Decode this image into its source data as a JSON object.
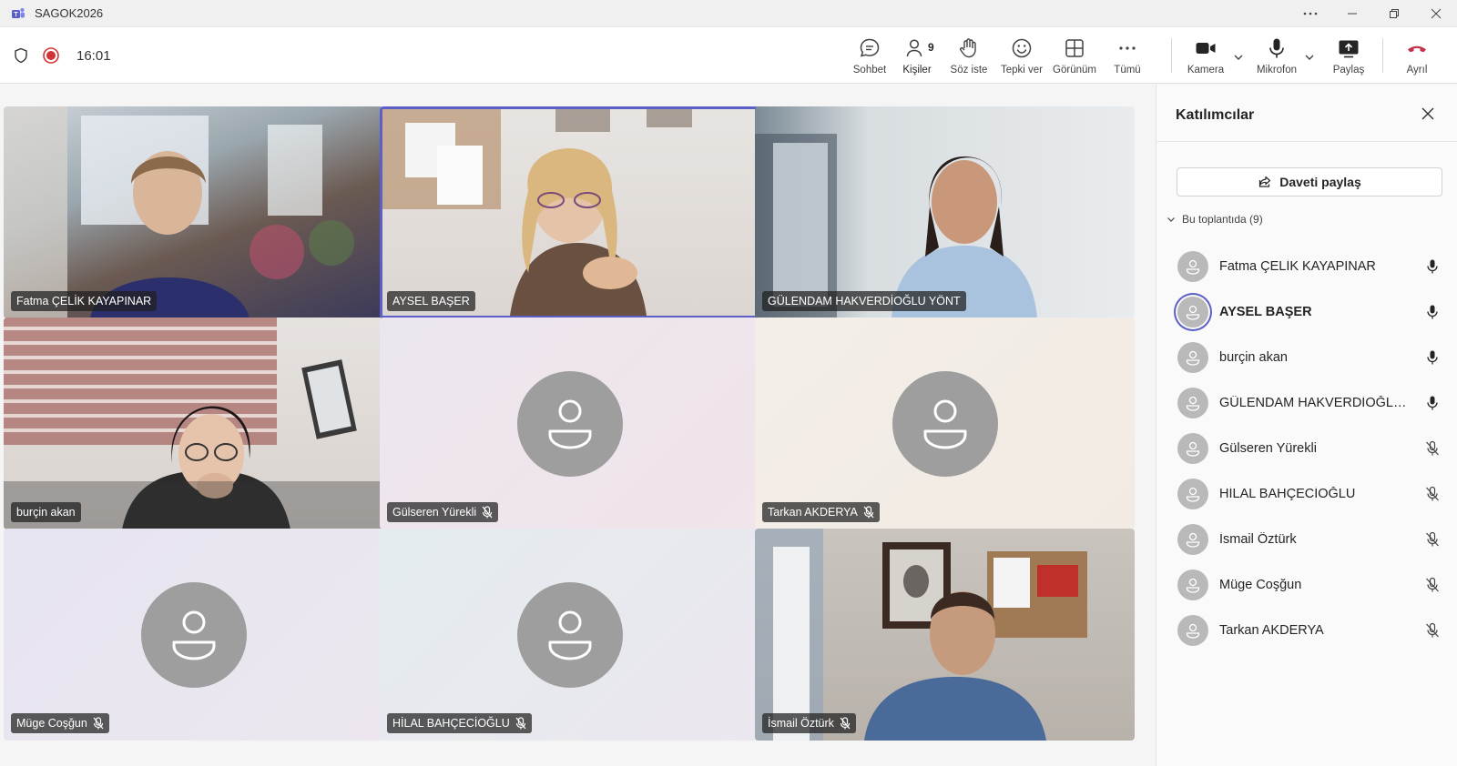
{
  "window": {
    "title": "SAGOK2026"
  },
  "meeting": {
    "timer": "16:01",
    "people_count": "9"
  },
  "toolbar": {
    "chat": "Sohbet",
    "people": "Kişiler",
    "raise_hand": "Söz iste",
    "react": "Tepki ver",
    "view": "Görünüm",
    "more": "Tümü",
    "camera": "Kamera",
    "mic": "Mikrofon",
    "share": "Paylaş",
    "leave": "Ayrıl"
  },
  "colors": {
    "accent": "#5b5fc7",
    "leave": "#c4314b",
    "record": "#d13438"
  },
  "tiles": [
    {
      "name": "Fatma ÇELİK KAYAPINAR",
      "video": true,
      "muted": false
    },
    {
      "name": "AYSEL BAŞER",
      "video": true,
      "muted": false,
      "speaking": true
    },
    {
      "name": "GÜLENDAM HAKVERDİOĞLU YÖNT",
      "video": true,
      "muted": false
    },
    {
      "name": "burçin akan",
      "video": true,
      "muted": false
    },
    {
      "name": "Gülseren Yürekli",
      "video": false,
      "muted": true
    },
    {
      "name": "Tarkan AKDERYA",
      "video": false,
      "muted": true
    },
    {
      "name": "Müge Coşğun",
      "video": false,
      "muted": true
    },
    {
      "name": "HİLAL BAHÇECİOĞLU",
      "video": false,
      "muted": true
    },
    {
      "name": "İsmail Öztürk",
      "video": true,
      "muted": true
    }
  ],
  "panel": {
    "title": "Katılımcılar",
    "invite": "Daveti paylaş",
    "section": "Bu toplantıda (9)",
    "participants": [
      {
        "name": "Fatma ÇELİK KAYAPINAR",
        "muted": false
      },
      {
        "name": "AYSEL BAŞER",
        "muted": false,
        "speaking": true
      },
      {
        "name": "burçin akan",
        "muted": false
      },
      {
        "name": "GÜLENDAM HAKVERDİOĞLU YÖNT",
        "muted": false
      },
      {
        "name": "Gülseren Yürekli",
        "muted": true
      },
      {
        "name": "HİLAL BAHÇECİOĞLU",
        "muted": true
      },
      {
        "name": "İsmail Öztürk",
        "muted": true
      },
      {
        "name": "Müge Coşğun",
        "muted": true
      },
      {
        "name": "Tarkan AKDERYA",
        "muted": true
      }
    ]
  }
}
